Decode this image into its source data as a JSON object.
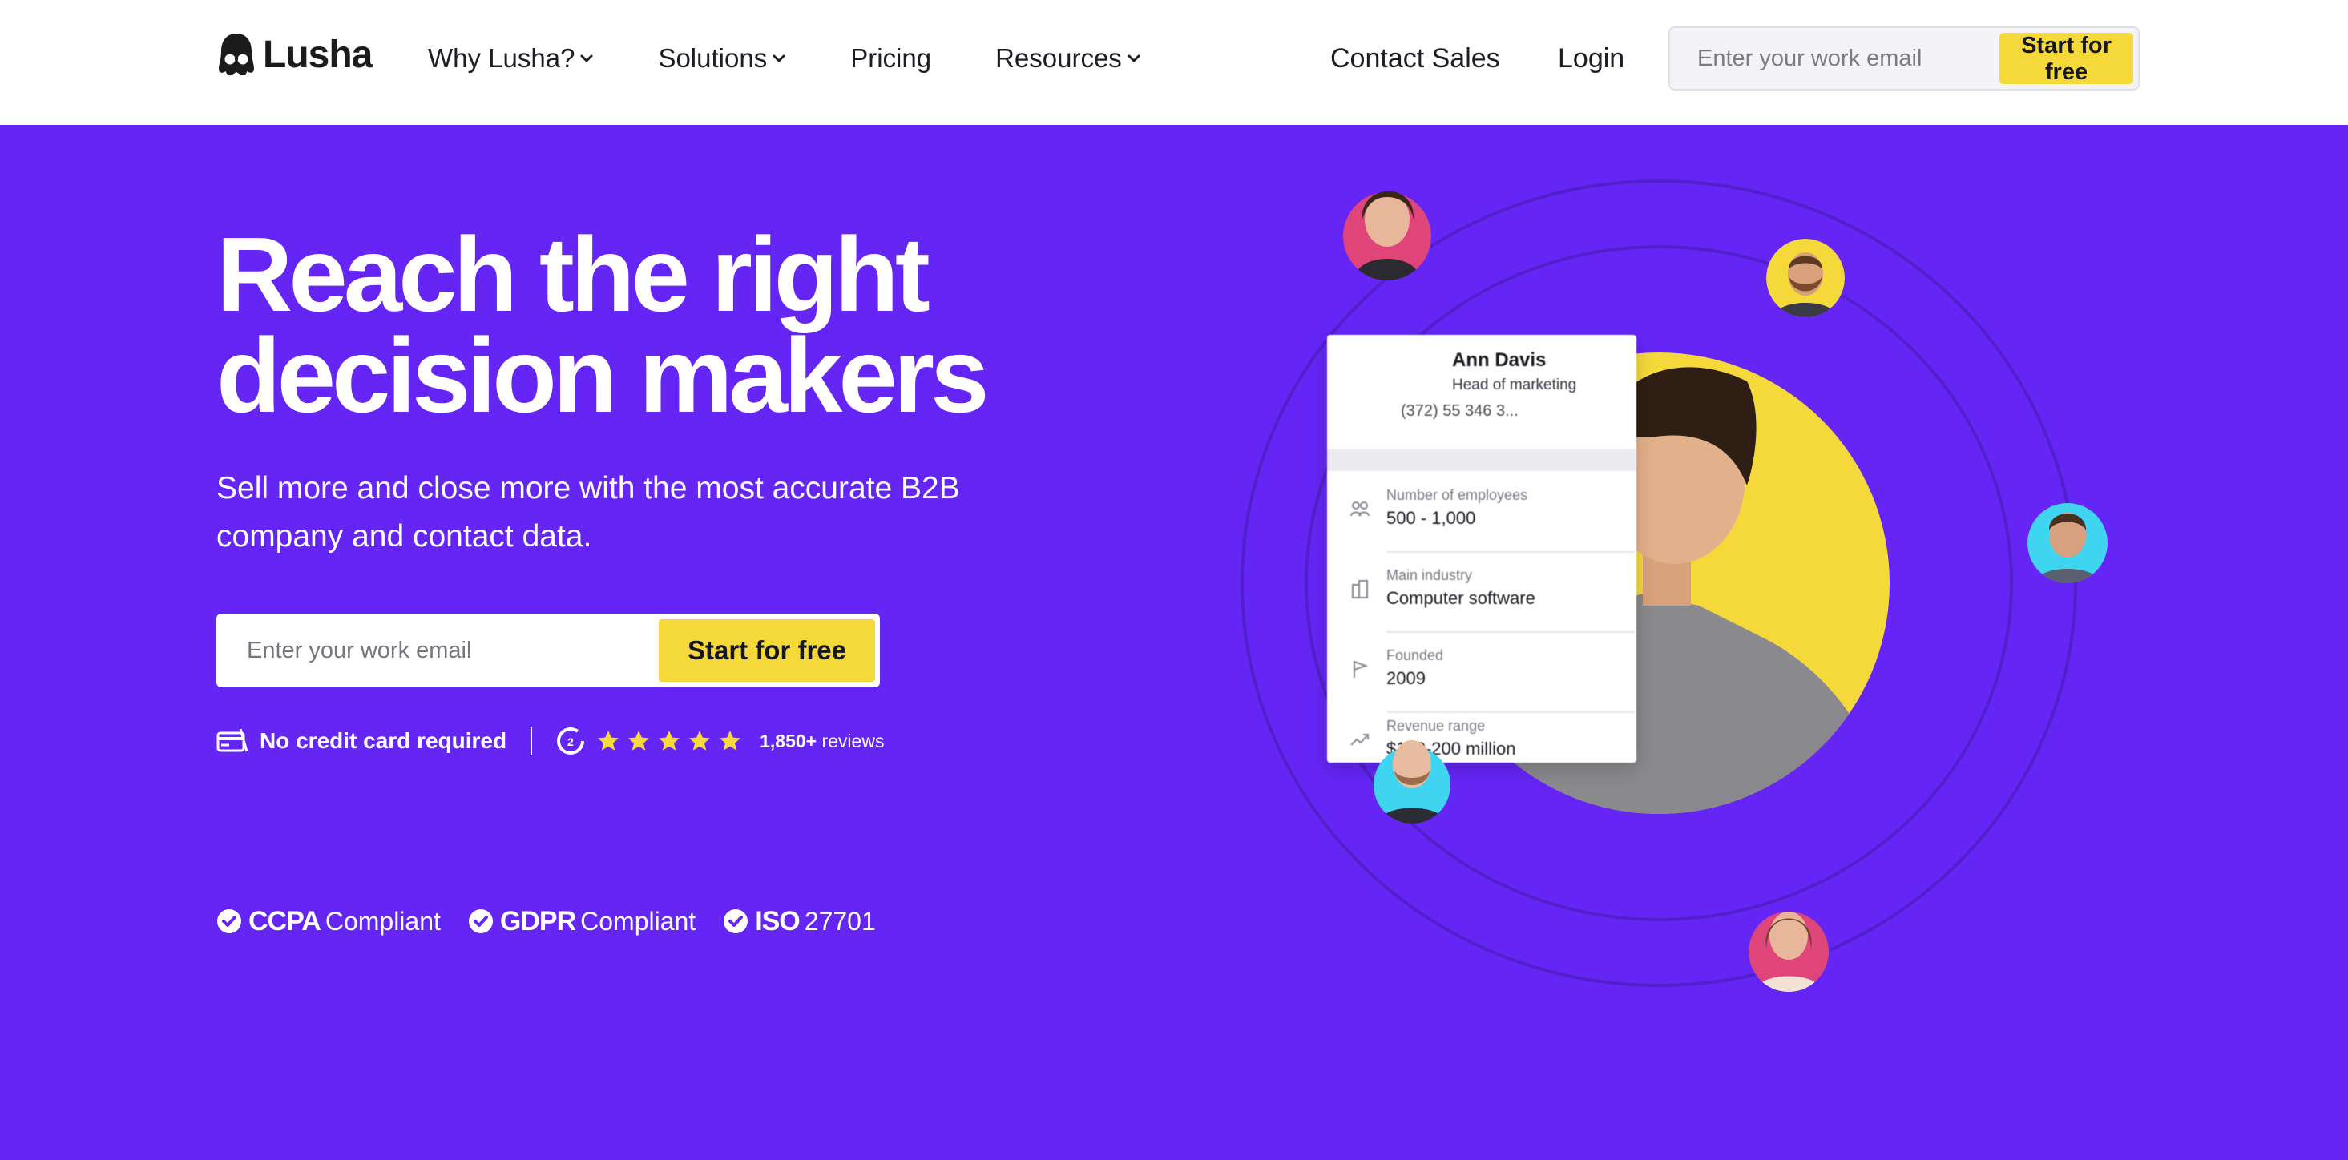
{
  "header": {
    "logo_text": "Lusha",
    "nav": [
      {
        "label": "Why Lusha?",
        "dropdown": true
      },
      {
        "label": "Solutions",
        "dropdown": true
      },
      {
        "label": "Pricing",
        "dropdown": false
      },
      {
        "label": "Resources",
        "dropdown": true
      }
    ],
    "contact_sales": "Contact Sales",
    "login": "Login",
    "email_placeholder": "Enter your work email",
    "cta": "Start for free"
  },
  "hero": {
    "headline_line1": "Reach the right",
    "headline_line2": "decision makers",
    "subheadline": "Sell more and close more with the most accurate B2B company and contact data.",
    "email_placeholder": "Enter your work email",
    "cta": "Start for free",
    "no_credit_card": "No credit card required",
    "rating_stars": 5,
    "reviews_count": "1,850+",
    "reviews_label": "reviews",
    "compliance": [
      {
        "strong": "CCPA",
        "light": "Compliant"
      },
      {
        "strong": "GDPR",
        "light": "Compliant"
      },
      {
        "strong": "ISO",
        "light": "27701"
      }
    ]
  },
  "contact_card": {
    "name": "Ann Davis",
    "role": "Head of marketing",
    "phone": "(372) 55 346 3...",
    "rows": [
      {
        "label": "Number of employees",
        "value": "500 - 1,000",
        "icon": "people-icon"
      },
      {
        "label": "Main industry",
        "value": "Computer software",
        "icon": "building-icon"
      },
      {
        "label": "Founded",
        "value": "2009",
        "icon": "flag-icon"
      },
      {
        "label": "Revenue range",
        "value": "$100-200 million",
        "icon": "trend-icon"
      }
    ]
  },
  "colors": {
    "brand_purple": "#6526f5",
    "accent_yellow": "#f5d93b",
    "text_dark": "#1d1d26"
  }
}
